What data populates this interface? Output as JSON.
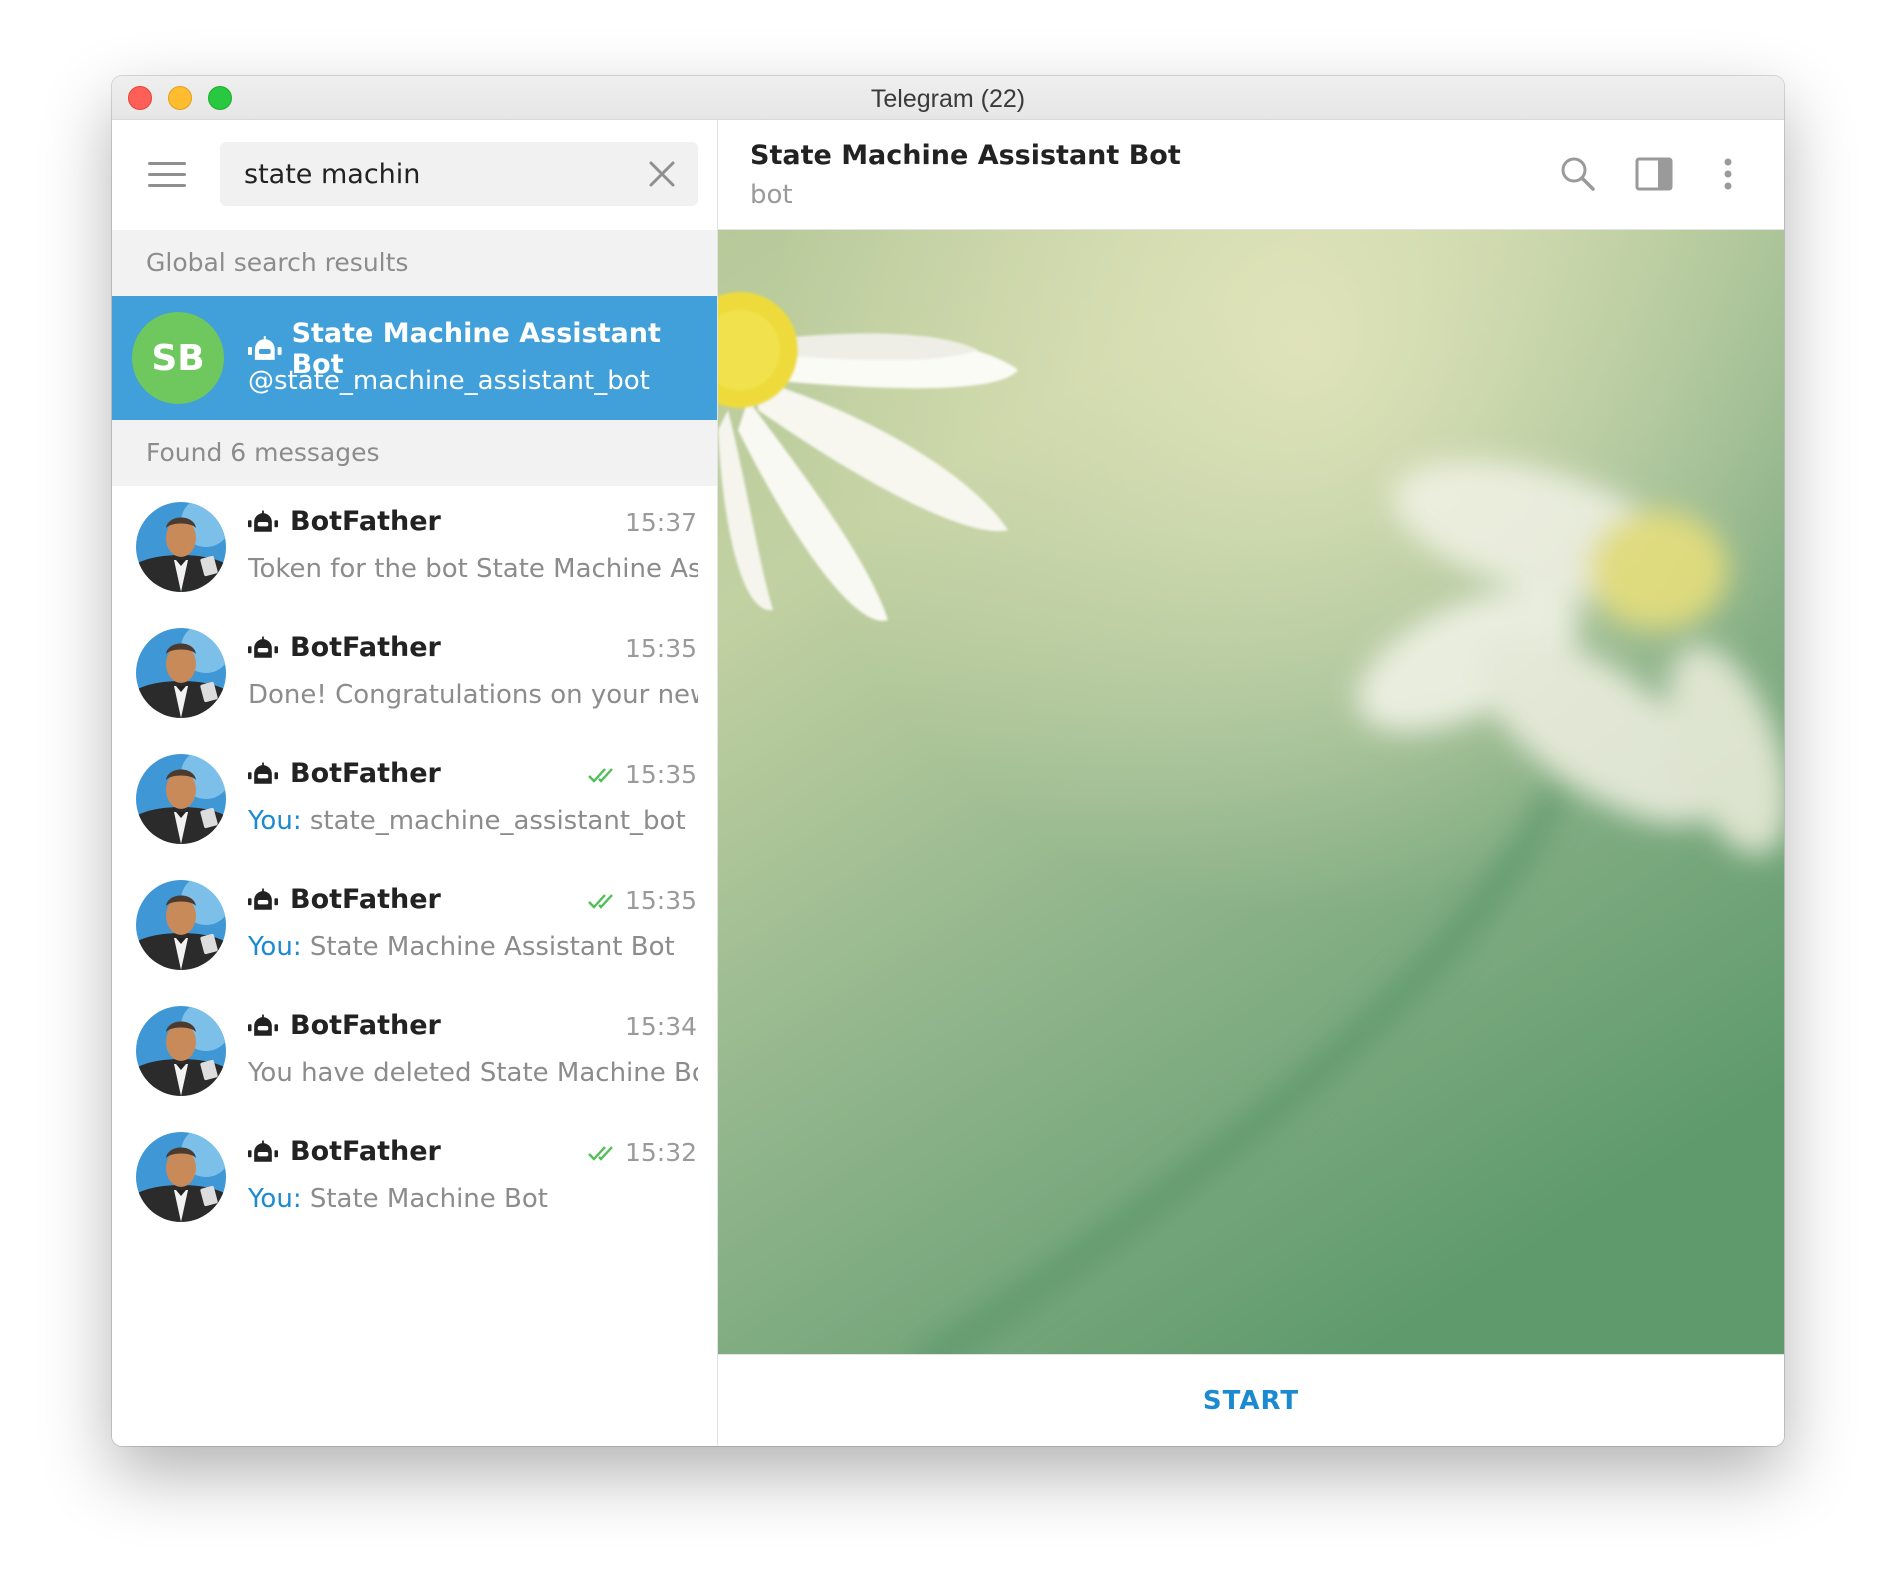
{
  "window": {
    "title": "Telegram (22)"
  },
  "sidebar": {
    "menu_icon": "hamburger-menu-icon",
    "search": {
      "value": "state machin",
      "clear_icon": "close-icon"
    },
    "global_header": "Global search results",
    "global_result": {
      "initials": "SB",
      "name": "State Machine Assistant Bot",
      "handle": "@state_machine_assistant_bot",
      "avatar_color": "#6fc85d",
      "highlight_color": "#419fd9"
    },
    "messages_header": "Found 6 messages",
    "messages": [
      {
        "name": "BotFather",
        "time": "15:37",
        "read": false,
        "prefix": "",
        "text": "Token for the bot State Machine As..."
      },
      {
        "name": "BotFather",
        "time": "15:35",
        "read": false,
        "prefix": "",
        "text": "Done! Congratulations on your new..."
      },
      {
        "name": "BotFather",
        "time": "15:35",
        "read": true,
        "prefix": "You:",
        "text": " state_machine_assistant_bot"
      },
      {
        "name": "BotFather",
        "time": "15:35",
        "read": true,
        "prefix": "You:",
        "text": " State Machine Assistant Bot"
      },
      {
        "name": "BotFather",
        "time": "15:34",
        "read": false,
        "prefix": "",
        "text": "You have deleted State Machine Bo..."
      },
      {
        "name": "BotFather",
        "time": "15:32",
        "read": true,
        "prefix": "You:",
        "text": " State Machine Bot"
      }
    ]
  },
  "chat": {
    "title": "State Machine Assistant Bot",
    "status": "bot",
    "icons": [
      "search-icon",
      "sidebar-toggle-icon",
      "more-vertical-icon"
    ],
    "start_label": "START",
    "accent_color": "#1b8ad1"
  }
}
